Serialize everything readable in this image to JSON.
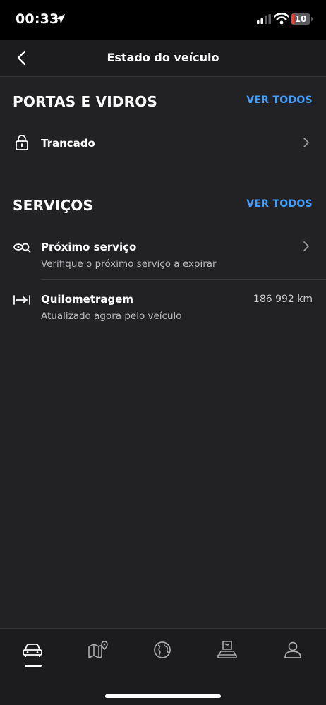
{
  "status_bar": {
    "time": "00:33",
    "battery": "10"
  },
  "header": {
    "title": "Estado do veículo"
  },
  "doors": {
    "section_title": "PORTAS E VIDROS",
    "see_all": "VER TODOS",
    "status_label": "Trancado"
  },
  "services": {
    "section_title": "SERVIÇOS",
    "see_all": "VER TODOS",
    "next_service": {
      "label": "Próximo serviço",
      "subtitle": "Verifique o próximo serviço a expirar"
    },
    "mileage": {
      "label": "Quilometragem",
      "subtitle": "Atualizado agora pelo veículo",
      "value": "186 992 km"
    }
  },
  "tabbar": {
    "items": [
      "car-icon",
      "map-icon",
      "globe-icon",
      "shop-icon",
      "profile-icon"
    ],
    "active_index": 0
  },
  "colors": {
    "accent": "#3f9dff",
    "background": "#222224",
    "bar": "#1c1c1e"
  }
}
